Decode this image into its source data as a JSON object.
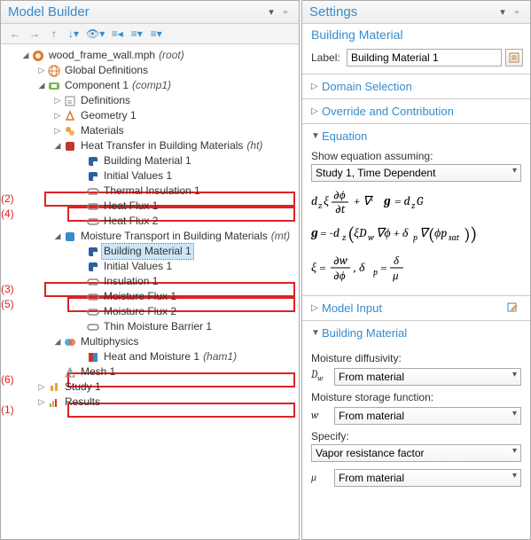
{
  "left": {
    "title": "Model Builder",
    "tree": {
      "root": {
        "label": "wood_frame_wall.mph",
        "suffix": "(root)"
      },
      "globaldef": "Global Definitions",
      "comp1": {
        "label": "Component 1",
        "suffix": "(comp1)"
      },
      "defs": "Definitions",
      "geom": "Geometry 1",
      "mats": "Materials",
      "ht": {
        "label": "Heat Transfer in Building Materials",
        "suffix": "(ht)"
      },
      "ht_bm": "Building Material 1",
      "ht_iv": "Initial Values 1",
      "ht_ti": "Thermal Insulation 1",
      "ht_hf1": "Heat Flux 1",
      "ht_hf2": "Heat Flux 2",
      "mt": {
        "label": "Moisture Transport in Building Materials",
        "suffix": "(mt)"
      },
      "mt_bm": "Building Material 1",
      "mt_iv": "Initial Values 1",
      "mt_ins": "Insulation 1",
      "mt_mf1": "Moisture Flux 1",
      "mt_mf2": "Moisture Flux 2",
      "mt_tmb": "Thin Moisture Barrier 1",
      "mp": "Multiphysics",
      "mp_ham": {
        "label": "Heat and Moisture 1",
        "suffix": "(ham1)"
      },
      "mesh": "Mesh 1",
      "study": "Study 1",
      "results": "Results"
    },
    "annots": {
      "a1": "(1)",
      "a2": "(2)",
      "a3": "(3)",
      "a4": "(4)",
      "a5": "(5)",
      "a6": "(6)"
    }
  },
  "right": {
    "title": "Settings",
    "subtitle": "Building Material",
    "label_text": "Label:",
    "label_value": "Building Material 1",
    "sections": {
      "domain": "Domain Selection",
      "override": "Override and Contribution",
      "equation": "Equation",
      "modelinput": "Model Input",
      "buildingmat": "Building Material"
    },
    "show_eq": "Show equation assuming:",
    "study_sel": "Study 1, Time Dependent",
    "bm": {
      "md_label": "Moisture diffusivity:",
      "md_sym": "D",
      "md_sub": "w",
      "msf_label": "Moisture storage function:",
      "msf_sym": "w",
      "spec_label": "Specify:",
      "spec_val": "Vapor resistance factor",
      "mu_sym": "μ",
      "from_material": "From material"
    }
  }
}
